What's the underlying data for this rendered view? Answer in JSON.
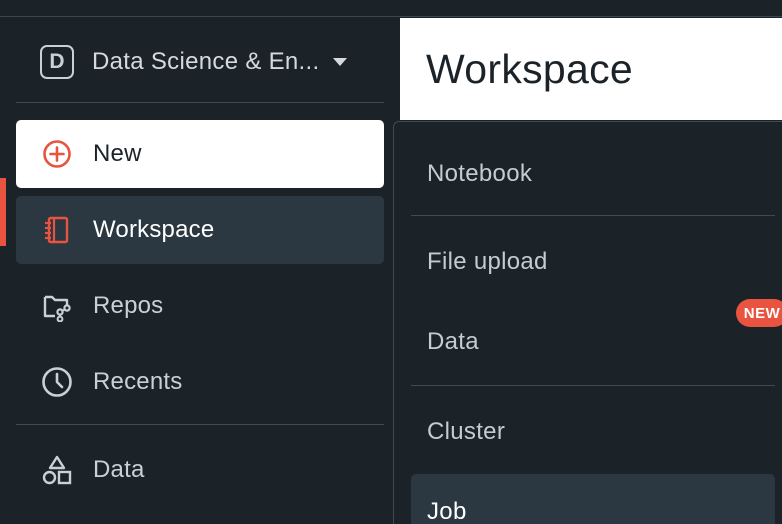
{
  "persona": {
    "badge": "D",
    "label": "Data Science & En...",
    "caret_icon": "chevron-down-icon"
  },
  "sidebar": {
    "items": [
      {
        "label": "New",
        "icon": "plus-circle-icon"
      },
      {
        "label": "Workspace",
        "icon": "notebook-icon"
      },
      {
        "label": "Repos",
        "icon": "repo-icon"
      },
      {
        "label": "Recents",
        "icon": "clock-icon"
      },
      {
        "label": "Data",
        "icon": "shapes-icon"
      }
    ]
  },
  "header": {
    "title": "Workspace"
  },
  "new_menu": {
    "items": [
      {
        "label": "Notebook"
      },
      {
        "label": "File upload"
      },
      {
        "label": "Data",
        "badge": "NEW"
      },
      {
        "label": "Cluster"
      },
      {
        "label": "Job"
      }
    ]
  },
  "colors": {
    "background": "#1b2329",
    "accent": "#e8543f",
    "active_item": "#2b3741",
    "text": "#c9d1d7"
  }
}
